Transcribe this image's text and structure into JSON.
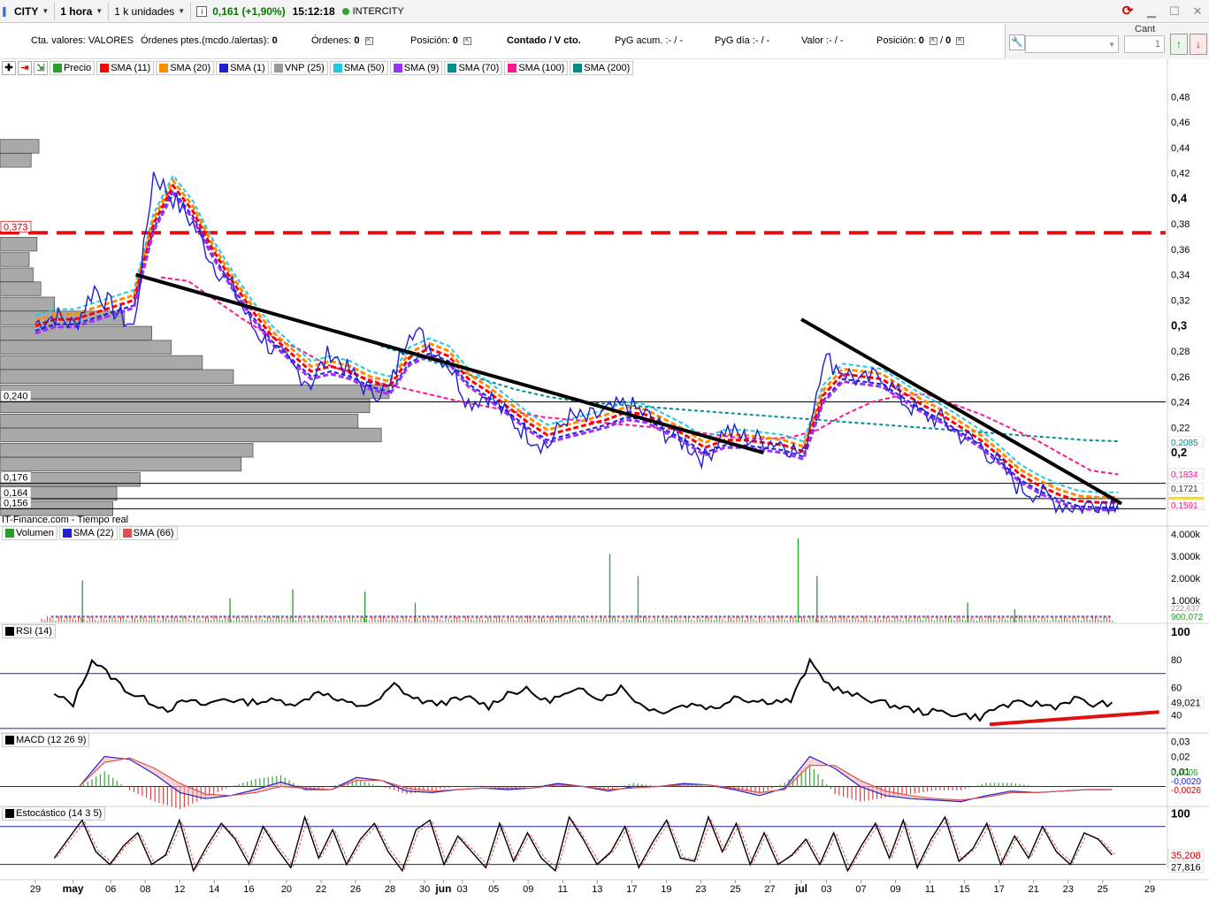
{
  "toolbar": {
    "symbol": "CITY",
    "timeframe": "1 hora",
    "units": "1 k unidades",
    "last_price": "0,161 (+1,90%)",
    "time": "15:12:18",
    "market": "INTERCITY",
    "info_icon_glyph": "i"
  },
  "account": {
    "cta_label": "Cta. valores:",
    "cta_value": "VALORES",
    "ordenes_ptes_label": "Órdenes ptes.(mcdo./alertas):",
    "ordenes_ptes_value": "0",
    "ordenes_label": "Órdenes:",
    "ordenes_value": "0",
    "posicion_label": "Posición:",
    "posicion_value": "0",
    "contado": "Contado / V cto.",
    "pyg_acum": "PyG acum. :- / -",
    "pyg_dia": "PyG día :- / -",
    "valor": "Valor :- / -",
    "posicion2_label": "Posición:",
    "posicion2_value": "0",
    "posicion2_sep": "/",
    "posicion2_value2": "0"
  },
  "order_panel": {
    "cant_label": "Cant",
    "qty_value": "1"
  },
  "legends": {
    "price": [
      {
        "label": "Precio",
        "color": "#2a9d2a",
        "icon": "price-chart-icon"
      },
      {
        "label": "SMA (11)",
        "color": "#ff0000"
      },
      {
        "label": "SMA (20)",
        "color": "#ff8c00"
      },
      {
        "label": "SMA (1)",
        "color": "#2020d0"
      },
      {
        "label": "VNP (25)",
        "color": "#999999"
      },
      {
        "label": "SMA (50)",
        "color": "#20c8e0"
      },
      {
        "label": "SMA (9)",
        "color": "#9b30ff"
      },
      {
        "label": "SMA (70)",
        "color": "#009090"
      },
      {
        "label": "SMA (100)",
        "color": "#ff1493"
      },
      {
        "label": "SMA (200)",
        "color": "#008b8b"
      }
    ],
    "volume": [
      {
        "label": "Volumen",
        "color": "#2a9d2a"
      },
      {
        "label": "SMA (22)",
        "color": "#2020d0"
      },
      {
        "label": "SMA (66)",
        "color": "#e05050"
      }
    ],
    "rsi": "RSI (14)",
    "macd": "MACD (12 26 9)",
    "stoch": "Estocástico (14 3 5)"
  },
  "source_label": "IT-Finance.com - Tiempo real",
  "chart_data": [
    {
      "type": "line",
      "panel": "price",
      "ylim": [
        0.15,
        0.49
      ],
      "y_ticks": [
        "0,48",
        "0,46",
        "0,44",
        "0,42",
        "0,4",
        "0,38",
        "0,36",
        "0,34",
        "0,32",
        "0,3",
        "0,28",
        "0,26",
        "0,24",
        "0,22",
        "0,2"
      ],
      "y_tick_values": [
        0.48,
        0.46,
        0.44,
        0.42,
        0.4,
        0.38,
        0.36,
        0.34,
        0.32,
        0.3,
        0.28,
        0.26,
        0.24,
        0.22,
        0.2
      ],
      "x_ticks": [
        "29",
        "may",
        "06",
        "08",
        "12",
        "14",
        "16",
        "20",
        "22",
        "26",
        "28",
        "30",
        "jun",
        "03",
        "05",
        "09",
        "11",
        "13",
        "17",
        "19",
        "23",
        "25",
        "27",
        "jul",
        "03",
        "07",
        "09",
        "11",
        "15",
        "17",
        "21",
        "23",
        "25",
        "29"
      ],
      "x_tick_values": [
        0,
        1.2,
        2.4,
        3.5,
        4.6,
        5.7,
        6.8,
        8.0,
        9.1,
        10.2,
        11.3,
        12.4,
        13.0,
        13.6,
        14.6,
        15.7,
        16.8,
        17.9,
        19.0,
        20.1,
        21.2,
        22.3,
        23.4,
        24.4,
        25.2,
        26.3,
        27.4,
        28.5,
        29.6,
        30.7,
        31.8,
        32.9,
        34.0,
        35.5
      ],
      "price": [
        0.302,
        0.308,
        0.3,
        0.33,
        0.312,
        0.298,
        0.42,
        0.4,
        0.38,
        0.35,
        0.33,
        0.3,
        0.282,
        0.268,
        0.255,
        0.28,
        0.262,
        0.248,
        0.25,
        0.3,
        0.285,
        0.27,
        0.24,
        0.246,
        0.228,
        0.215,
        0.205,
        0.228,
        0.226,
        0.232,
        0.238,
        0.23,
        0.216,
        0.208,
        0.195,
        0.218,
        0.212,
        0.21,
        0.208,
        0.197,
        0.275,
        0.265,
        0.255,
        0.262,
        0.242,
        0.23,
        0.226,
        0.214,
        0.206,
        0.19,
        0.172,
        0.168,
        0.16,
        0.157,
        0.162,
        0.161
      ],
      "price_x_range": [
        0,
        34.5
      ],
      "sma_fast": [
        0.3,
        0.305,
        0.305,
        0.31,
        0.315,
        0.32,
        0.38,
        0.41,
        0.39,
        0.36,
        0.335,
        0.312,
        0.292,
        0.278,
        0.264,
        0.268,
        0.264,
        0.256,
        0.252,
        0.275,
        0.282,
        0.276,
        0.258,
        0.248,
        0.236,
        0.224,
        0.214,
        0.218,
        0.222,
        0.226,
        0.232,
        0.23,
        0.222,
        0.214,
        0.204,
        0.21,
        0.21,
        0.208,
        0.206,
        0.201,
        0.245,
        0.262,
        0.26,
        0.258,
        0.248,
        0.238,
        0.23,
        0.22,
        0.21,
        0.197,
        0.183,
        0.174,
        0.167,
        0.162,
        0.161,
        0.161
      ],
      "sma_100": [
        0.338,
        0.335,
        0.32,
        0.305,
        0.292,
        0.282,
        0.27,
        0.262,
        0.255,
        0.25,
        0.245,
        0.24,
        0.236,
        0.232,
        0.228,
        0.226,
        0.224,
        0.222,
        0.22,
        0.218,
        0.215,
        0.212,
        0.211,
        0.212,
        0.218,
        0.23,
        0.24,
        0.245,
        0.246,
        0.238,
        0.23,
        0.22,
        0.21,
        0.198,
        0.186,
        0.183
      ],
      "sma_100_x_range": [
        4.0,
        34.5
      ],
      "sma_200": [
        0.284,
        0.276,
        0.268,
        0.258,
        0.25,
        0.244,
        0.24,
        0.238,
        0.236,
        0.234,
        0.232,
        0.23,
        0.228,
        0.226,
        0.224,
        0.222,
        0.22,
        0.218,
        0.216,
        0.214,
        0.212,
        0.21,
        0.209
      ],
      "sma_200_x_range": [
        11.0,
        34.5
      ],
      "annotations": {
        "resistance_dashed": 0.373,
        "resistance_label": "0,373",
        "h_lines": [
          0.24,
          0.176,
          0.164,
          0.156
        ],
        "h_line_labels": [
          "0,240",
          "0,176",
          "0,164",
          "0,156"
        ],
        "right_labels": [
          {
            "text": "0,2085",
            "value": 0.2085,
            "color": "#008b8b"
          },
          {
            "text": "0,1834",
            "value": 0.1834,
            "color": "#ff1493"
          },
          {
            "text": "0,1721",
            "value": 0.1721,
            "color": "#333333"
          },
          {
            "text": "0,161",
            "value": 0.161,
            "color": "#000000",
            "bg": "#ffe000"
          },
          {
            "text": "0,1591",
            "value": 0.1591,
            "color": "#ff1493"
          }
        ],
        "trendlines": [
          {
            "x1": 3.2,
            "y1": 0.34,
            "x2": 23.2,
            "y2": 0.2
          },
          {
            "x1": 24.4,
            "y1": 0.305,
            "x2": 34.6,
            "y2": 0.16
          }
        ],
        "volume_profile": [
          {
            "price": 0.441,
            "width": 0.1
          },
          {
            "price": 0.43,
            "width": 0.08
          },
          {
            "price": 0.364,
            "width": 0.095
          },
          {
            "price": 0.352,
            "width": 0.075
          },
          {
            "price": 0.34,
            "width": 0.085
          },
          {
            "price": 0.329,
            "width": 0.105
          },
          {
            "price": 0.317,
            "width": 0.14
          },
          {
            "price": 0.306,
            "width": 0.32
          },
          {
            "price": 0.294,
            "width": 0.39
          },
          {
            "price": 0.283,
            "width": 0.44
          },
          {
            "price": 0.271,
            "width": 0.52
          },
          {
            "price": 0.26,
            "width": 0.6
          },
          {
            "price": 0.248,
            "width": 1.0
          },
          {
            "price": 0.237,
            "width": 0.95
          },
          {
            "price": 0.225,
            "width": 0.92
          },
          {
            "price": 0.214,
            "width": 0.98
          },
          {
            "price": 0.202,
            "width": 0.65
          },
          {
            "price": 0.191,
            "width": 0.62
          },
          {
            "price": 0.179,
            "width": 0.36
          },
          {
            "price": 0.168,
            "width": 0.3
          },
          {
            "price": 0.156,
            "width": 0.29
          }
        ]
      }
    },
    {
      "type": "bar",
      "panel": "volume",
      "ylim": [
        0,
        4200
      ],
      "y_ticks": [
        "4.000k",
        "3.000k",
        "2.000k",
        "1.000k"
      ],
      "y_tick_values": [
        4000,
        3000,
        2000,
        1000
      ],
      "right_labels": [
        "222,637",
        "900,072"
      ],
      "spikes": [
        [
          1.5,
          1900
        ],
        [
          6.2,
          1100
        ],
        [
          8.2,
          1500
        ],
        [
          10.5,
          1400
        ],
        [
          12.1,
          900
        ],
        [
          18.3,
          3100
        ],
        [
          19.2,
          2100
        ],
        [
          24.3,
          3800
        ],
        [
          24.9,
          2100
        ],
        [
          29.7,
          900
        ],
        [
          31.2,
          600
        ]
      ],
      "baseline": 250,
      "sma_22": 280,
      "sma_66": 230
    },
    {
      "type": "line",
      "panel": "rsi",
      "ylim": [
        28,
        102
      ],
      "y_ticks": [
        "100",
        "80",
        "60",
        "40"
      ],
      "y_tick_values": [
        100,
        80,
        60,
        40
      ],
      "h_lines": [
        70,
        30
      ],
      "last_label": "49,021",
      "values": [
        54,
        48,
        80,
        68,
        56,
        50,
        44,
        50,
        47,
        52,
        49,
        50,
        50,
        48,
        58,
        50,
        47,
        48,
        62,
        52,
        48,
        50,
        52,
        46,
        56,
        58,
        50,
        54,
        58,
        52,
        60,
        48,
        42,
        46,
        48,
        44,
        54,
        50,
        50,
        50,
        78,
        62,
        55,
        52,
        48,
        45,
        42,
        42,
        40,
        38,
        46,
        48,
        48,
        46,
        52,
        47,
        49
      ],
      "values_x_range": [
        0.6,
        34.3
      ],
      "trendline": {
        "x1": 30.4,
        "y1": 33,
        "x2": 35.8,
        "y2": 42
      }
    },
    {
      "type": "line",
      "panel": "macd",
      "ylim": [
        -0.012,
        0.032
      ],
      "y_ticks": [
        "0,03",
        "0,02",
        "0,01"
      ],
      "y_tick_values": [
        0.03,
        0.02,
        0.01
      ],
      "right_labels": [
        "0,0006",
        "-0,0020",
        "-0,0026"
      ],
      "macd": [
        0.0,
        0.02,
        0.018,
        0.008,
        -0.004,
        -0.008,
        -0.006,
        -0.002,
        0.003,
        -0.002,
        -0.002,
        0.006,
        0.004,
        -0.003,
        -0.004,
        -0.002,
        -0.001,
        -0.002,
        -0.001,
        0.002,
        0.0,
        -0.003,
        0.0,
        0.0,
        0.002,
        0.001,
        -0.002,
        -0.006,
        -0.001,
        0.02,
        0.012,
        0.0,
        -0.006,
        -0.008,
        -0.009,
        -0.01,
        -0.006,
        -0.003,
        -0.004,
        -0.003,
        -0.002,
        -0.002
      ],
      "signal": [
        0.0,
        0.016,
        0.019,
        0.012,
        0.002,
        -0.005,
        -0.006,
        -0.004,
        0.0,
        -0.001,
        -0.002,
        0.004,
        0.004,
        -0.001,
        -0.003,
        -0.002,
        -0.001,
        -0.001,
        -0.001,
        0.001,
        0.0,
        -0.002,
        -0.001,
        0.0,
        0.001,
        0.001,
        -0.001,
        -0.004,
        -0.002,
        0.014,
        0.014,
        0.004,
        -0.003,
        -0.006,
        -0.008,
        -0.009,
        -0.007,
        -0.004,
        -0.004,
        -0.003,
        -0.002,
        -0.002
      ],
      "values_x_range": [
        1.4,
        34.3
      ]
    },
    {
      "type": "line",
      "panel": "stochastic",
      "ylim": [
        0,
        102
      ],
      "y_ticks": [
        "100"
      ],
      "y_tick_values": [
        100
      ],
      "h_lines": [
        80,
        20
      ],
      "right_labels": [
        "35,208",
        "27,816"
      ],
      "values": [
        30,
        60,
        90,
        40,
        20,
        50,
        70,
        20,
        35,
        90,
        10,
        50,
        85,
        60,
        20,
        80,
        45,
        15,
        95,
        30,
        75,
        20,
        60,
        85,
        40,
        10,
        75,
        90,
        20,
        65,
        40,
        15,
        85,
        25,
        70,
        30,
        10,
        95,
        60,
        20,
        40,
        80,
        15,
        55,
        90,
        30,
        25,
        95,
        40,
        85,
        20,
        70,
        20,
        35,
        60,
        20,
        70,
        10,
        50,
        85,
        30,
        90,
        15,
        60,
        95,
        25,
        45,
        85,
        20,
        65,
        30,
        80,
        40,
        20,
        70,
        60,
        35
      ],
      "values_x_range": [
        0.6,
        34.3
      ]
    }
  ]
}
